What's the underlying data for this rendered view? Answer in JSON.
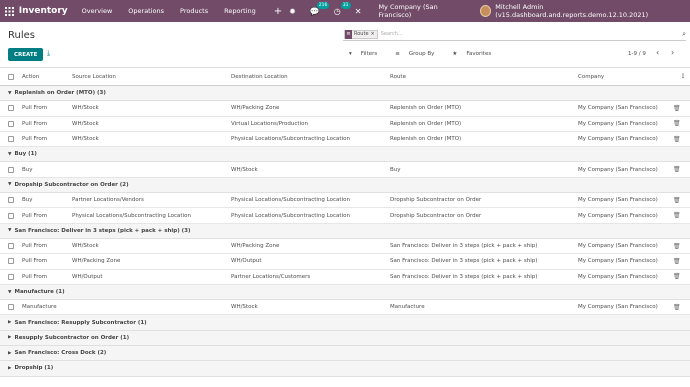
{
  "navbar": {
    "brand": "Inventory",
    "menus": [
      "Overview",
      "Operations",
      "Products",
      "Reporting"
    ],
    "plus": "+",
    "msg_count": "216",
    "activity_count": "31",
    "company": "My Company (San Francisco)",
    "user": "Mitchell Admin (v15.dashboard.and.reports.demo.12.10.2021)"
  },
  "control": {
    "title": "Rules",
    "facet_label": "Route",
    "facet_x": "×",
    "search_placeholder": "Search...",
    "create_label": "CREATE",
    "filters_label": "Filters",
    "groupby_label": "Group By",
    "favorites_label": "Favorites",
    "pager": "1-9 / 9"
  },
  "columns": [
    "Action",
    "Source Location",
    "Destination Location",
    "Route",
    "Company"
  ],
  "groups": [
    {
      "title": "Replenish on Order (MTO) (3)",
      "open": true,
      "rows": [
        [
          "Pull From",
          "WH/Stock",
          "WH/Packing Zone",
          "Replenish on Order (MTO)",
          "My Company (San Francisco)"
        ],
        [
          "Pull From",
          "WH/Stock",
          "Virtual Locations/Production",
          "Replenish on Order (MTO)",
          "My Company (San Francisco)"
        ],
        [
          "Pull From",
          "WH/Stock",
          "Physical Locations/Subcontracting Location",
          "Replenish on Order (MTO)",
          "My Company (San Francisco)"
        ]
      ]
    },
    {
      "title": "Buy (1)",
      "open": true,
      "rows": [
        [
          "Buy",
          "",
          "WH/Stock",
          "Buy",
          "My Company (San Francisco)"
        ]
      ]
    },
    {
      "title": "Dropship Subcontractor on Order (2)",
      "open": true,
      "rows": [
        [
          "Buy",
          "Partner Locations/Vendors",
          "Physical Locations/Subcontracting Location",
          "Dropship Subcontractor on Order",
          "My Company (San Francisco)"
        ],
        [
          "Pull From",
          "Physical Locations/Subcontracting Location",
          "Physical Locations/Subcontracting Location",
          "Dropship Subcontractor on Order",
          "My Company (San Francisco)"
        ]
      ]
    },
    {
      "title": "San Francisco: Deliver in 3 steps (pick + pack + ship) (3)",
      "open": true,
      "rows": [
        [
          "Pull From",
          "WH/Stock",
          "WH/Packing Zone",
          "San Francisco: Deliver in 3 steps (pick + pack + ship)",
          "My Company (San Francisco)"
        ],
        [
          "Pull From",
          "WH/Packing Zone",
          "WH/Output",
          "San Francisco: Deliver in 3 steps (pick + pack + ship)",
          "My Company (San Francisco)"
        ],
        [
          "Pull From",
          "WH/Output",
          "Partner Locations/Customers",
          "San Francisco: Deliver in 3 steps (pick + pack + ship)",
          "My Company (San Francisco)"
        ]
      ]
    },
    {
      "title": "Manufacture (1)",
      "open": true,
      "rows": [
        [
          "Manufacture",
          "",
          "WH/Stock",
          "Manufacture",
          "My Company (San Francisco)"
        ]
      ]
    },
    {
      "title": "San Francisco: Resupply Subcontractor (1)",
      "open": false,
      "rows": []
    },
    {
      "title": "Resupply Subcontractor on Order (1)",
      "open": false,
      "rows": []
    },
    {
      "title": "San Francisco: Cross Dock (2)",
      "open": false,
      "rows": []
    },
    {
      "title": "Dropship (1)",
      "open": false,
      "rows": []
    }
  ],
  "colors": {
    "brand": "#714b67",
    "primary": "#017e84"
  }
}
